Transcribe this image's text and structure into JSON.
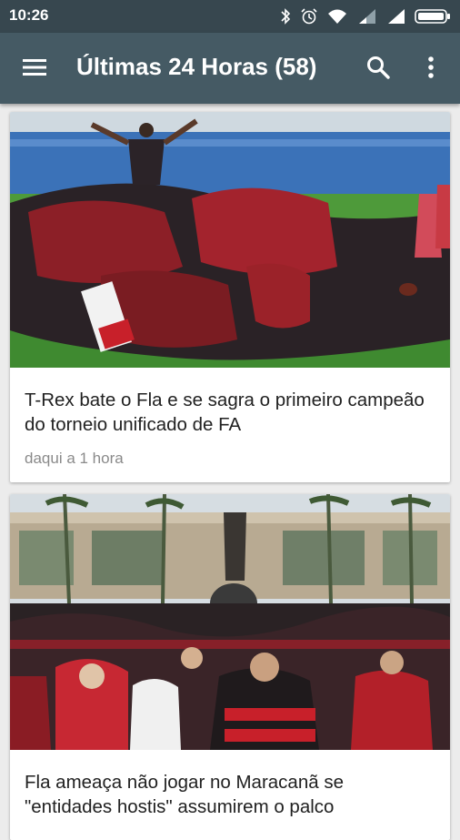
{
  "status_bar": {
    "time": "10:26",
    "icons": [
      "bluetooth-icon",
      "alarm-icon",
      "wifi-icon",
      "signal-icon",
      "signal-icon",
      "battery-icon"
    ]
  },
  "app_bar": {
    "title": "Últimas 24 Horas (58)",
    "background": "#455a64",
    "icons": [
      "menu-icon",
      "search-icon",
      "more-vert-icon"
    ]
  },
  "articles": [
    {
      "title": "T-Rex bate o Fla e se sagra o primeiro campeão do torneio unificado de FA",
      "time": "daqui a 1 hora"
    },
    {
      "title": "Fla ameaça não jogar no Maracanã se \"entidades hostis\" assumirem o palco"
    }
  ]
}
